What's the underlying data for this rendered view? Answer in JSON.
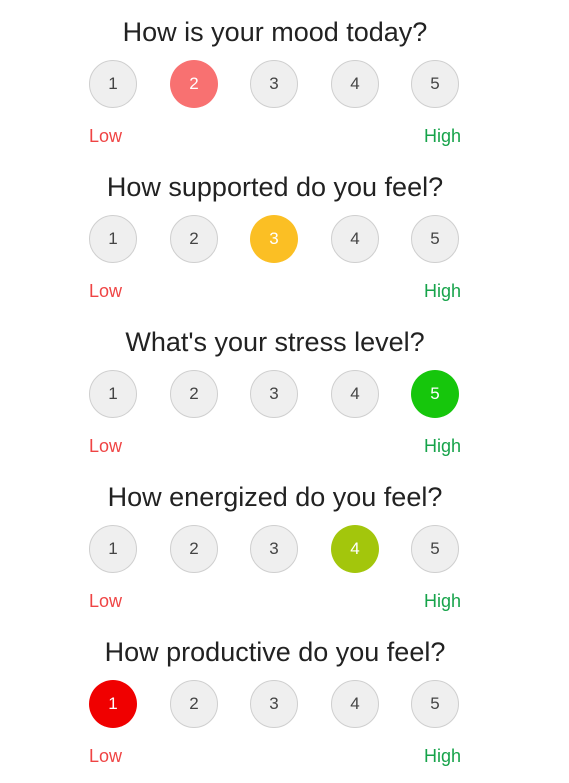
{
  "scale": {
    "low_label": "Low",
    "high_label": "High",
    "low_color": "#ef4444",
    "high_color": "#16a34a"
  },
  "questions": [
    {
      "title": "How is your mood today?",
      "options": [
        "1",
        "2",
        "3",
        "4",
        "5"
      ],
      "selected": 2,
      "selected_color": "#f87171"
    },
    {
      "title": "How supported do you feel?",
      "options": [
        "1",
        "2",
        "3",
        "4",
        "5"
      ],
      "selected": 3,
      "selected_color": "#fbbf24"
    },
    {
      "title": "What's your stress level?",
      "options": [
        "1",
        "2",
        "3",
        "4",
        "5"
      ],
      "selected": 5,
      "selected_color": "#16c60c"
    },
    {
      "title": "How energized do you feel?",
      "options": [
        "1",
        "2",
        "3",
        "4",
        "5"
      ],
      "selected": 4,
      "selected_color": "#a3c60c"
    },
    {
      "title": "How productive do you feel?",
      "options": [
        "1",
        "2",
        "3",
        "4",
        "5"
      ],
      "selected": 1,
      "selected_color": "#f00000"
    }
  ]
}
